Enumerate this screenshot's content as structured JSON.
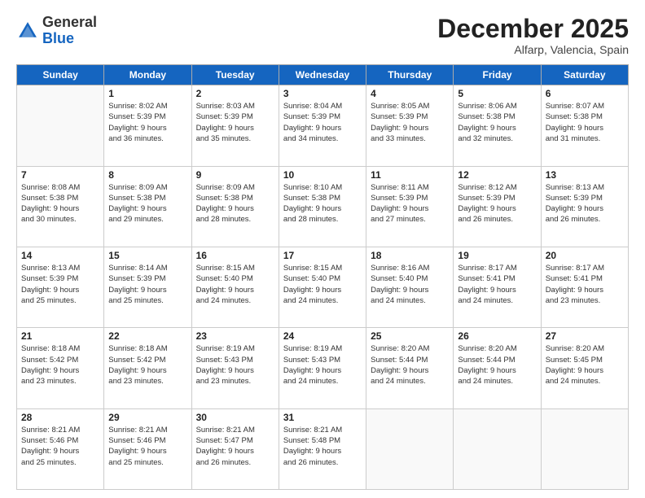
{
  "header": {
    "logo_line1": "General",
    "logo_line2": "Blue",
    "month_year": "December 2025",
    "location": "Alfarp, Valencia, Spain"
  },
  "weekdays": [
    "Sunday",
    "Monday",
    "Tuesday",
    "Wednesday",
    "Thursday",
    "Friday",
    "Saturday"
  ],
  "weeks": [
    [
      {
        "day": "",
        "info": ""
      },
      {
        "day": "1",
        "info": "Sunrise: 8:02 AM\nSunset: 5:39 PM\nDaylight: 9 hours\nand 36 minutes."
      },
      {
        "day": "2",
        "info": "Sunrise: 8:03 AM\nSunset: 5:39 PM\nDaylight: 9 hours\nand 35 minutes."
      },
      {
        "day": "3",
        "info": "Sunrise: 8:04 AM\nSunset: 5:39 PM\nDaylight: 9 hours\nand 34 minutes."
      },
      {
        "day": "4",
        "info": "Sunrise: 8:05 AM\nSunset: 5:39 PM\nDaylight: 9 hours\nand 33 minutes."
      },
      {
        "day": "5",
        "info": "Sunrise: 8:06 AM\nSunset: 5:38 PM\nDaylight: 9 hours\nand 32 minutes."
      },
      {
        "day": "6",
        "info": "Sunrise: 8:07 AM\nSunset: 5:38 PM\nDaylight: 9 hours\nand 31 minutes."
      }
    ],
    [
      {
        "day": "7",
        "info": "Sunrise: 8:08 AM\nSunset: 5:38 PM\nDaylight: 9 hours\nand 30 minutes."
      },
      {
        "day": "8",
        "info": "Sunrise: 8:09 AM\nSunset: 5:38 PM\nDaylight: 9 hours\nand 29 minutes."
      },
      {
        "day": "9",
        "info": "Sunrise: 8:09 AM\nSunset: 5:38 PM\nDaylight: 9 hours\nand 28 minutes."
      },
      {
        "day": "10",
        "info": "Sunrise: 8:10 AM\nSunset: 5:38 PM\nDaylight: 9 hours\nand 28 minutes."
      },
      {
        "day": "11",
        "info": "Sunrise: 8:11 AM\nSunset: 5:39 PM\nDaylight: 9 hours\nand 27 minutes."
      },
      {
        "day": "12",
        "info": "Sunrise: 8:12 AM\nSunset: 5:39 PM\nDaylight: 9 hours\nand 26 minutes."
      },
      {
        "day": "13",
        "info": "Sunrise: 8:13 AM\nSunset: 5:39 PM\nDaylight: 9 hours\nand 26 minutes."
      }
    ],
    [
      {
        "day": "14",
        "info": "Sunrise: 8:13 AM\nSunset: 5:39 PM\nDaylight: 9 hours\nand 25 minutes."
      },
      {
        "day": "15",
        "info": "Sunrise: 8:14 AM\nSunset: 5:39 PM\nDaylight: 9 hours\nand 25 minutes."
      },
      {
        "day": "16",
        "info": "Sunrise: 8:15 AM\nSunset: 5:40 PM\nDaylight: 9 hours\nand 24 minutes."
      },
      {
        "day": "17",
        "info": "Sunrise: 8:15 AM\nSunset: 5:40 PM\nDaylight: 9 hours\nand 24 minutes."
      },
      {
        "day": "18",
        "info": "Sunrise: 8:16 AM\nSunset: 5:40 PM\nDaylight: 9 hours\nand 24 minutes."
      },
      {
        "day": "19",
        "info": "Sunrise: 8:17 AM\nSunset: 5:41 PM\nDaylight: 9 hours\nand 24 minutes."
      },
      {
        "day": "20",
        "info": "Sunrise: 8:17 AM\nSunset: 5:41 PM\nDaylight: 9 hours\nand 23 minutes."
      }
    ],
    [
      {
        "day": "21",
        "info": "Sunrise: 8:18 AM\nSunset: 5:42 PM\nDaylight: 9 hours\nand 23 minutes."
      },
      {
        "day": "22",
        "info": "Sunrise: 8:18 AM\nSunset: 5:42 PM\nDaylight: 9 hours\nand 23 minutes."
      },
      {
        "day": "23",
        "info": "Sunrise: 8:19 AM\nSunset: 5:43 PM\nDaylight: 9 hours\nand 23 minutes."
      },
      {
        "day": "24",
        "info": "Sunrise: 8:19 AM\nSunset: 5:43 PM\nDaylight: 9 hours\nand 24 minutes."
      },
      {
        "day": "25",
        "info": "Sunrise: 8:20 AM\nSunset: 5:44 PM\nDaylight: 9 hours\nand 24 minutes."
      },
      {
        "day": "26",
        "info": "Sunrise: 8:20 AM\nSunset: 5:44 PM\nDaylight: 9 hours\nand 24 minutes."
      },
      {
        "day": "27",
        "info": "Sunrise: 8:20 AM\nSunset: 5:45 PM\nDaylight: 9 hours\nand 24 minutes."
      }
    ],
    [
      {
        "day": "28",
        "info": "Sunrise: 8:21 AM\nSunset: 5:46 PM\nDaylight: 9 hours\nand 25 minutes."
      },
      {
        "day": "29",
        "info": "Sunrise: 8:21 AM\nSunset: 5:46 PM\nDaylight: 9 hours\nand 25 minutes."
      },
      {
        "day": "30",
        "info": "Sunrise: 8:21 AM\nSunset: 5:47 PM\nDaylight: 9 hours\nand 26 minutes."
      },
      {
        "day": "31",
        "info": "Sunrise: 8:21 AM\nSunset: 5:48 PM\nDaylight: 9 hours\nand 26 minutes."
      },
      {
        "day": "",
        "info": ""
      },
      {
        "day": "",
        "info": ""
      },
      {
        "day": "",
        "info": ""
      }
    ]
  ]
}
